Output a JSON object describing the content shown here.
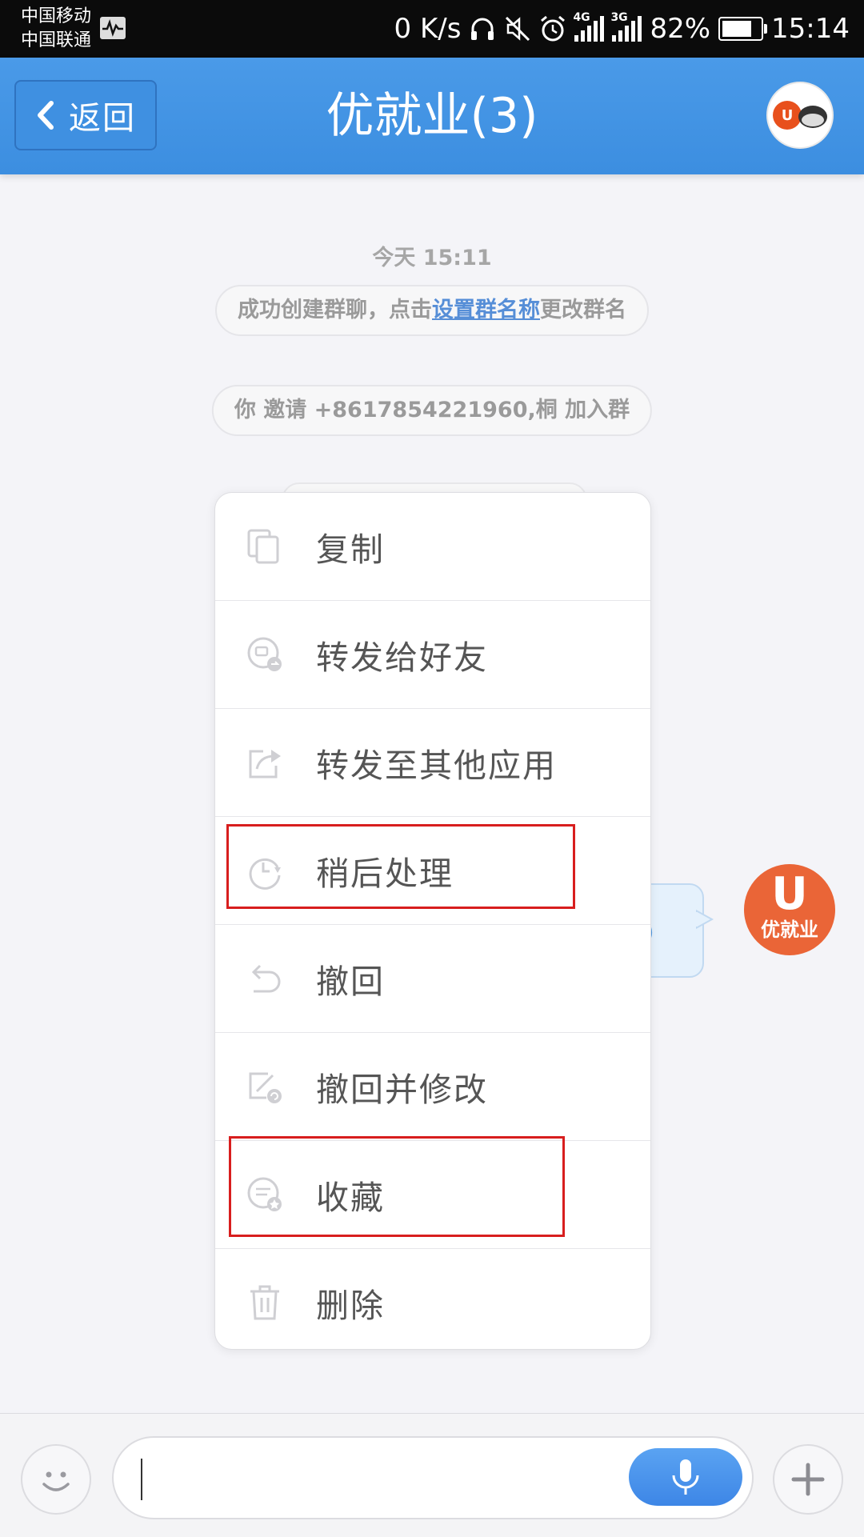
{
  "status_bar": {
    "carrier_1": "中国移动",
    "carrier_2": "中国联通",
    "net_speed": "0 K/s",
    "net_type_1": "4G",
    "net_type_2": "3G",
    "battery": "82%",
    "time": "15:14"
  },
  "header": {
    "back_label": "返回",
    "title": "优就业(3)"
  },
  "chat": {
    "timestamp": "今天 15:11",
    "system_messages": [
      {
        "before": "成功创建群聊，点击",
        "link": "设置群名称",
        "after": "更改群名"
      },
      {
        "text": "你 邀请 +8617854221960,桐 加入群"
      }
    ],
    "avatar_letter": "U",
    "avatar_brand": "优就业"
  },
  "context_menu": {
    "items": [
      {
        "label": "复制",
        "icon": "copy-icon"
      },
      {
        "label": "转发给好友",
        "icon": "forward-friend-icon"
      },
      {
        "label": "转发至其他应用",
        "icon": "share-external-icon"
      },
      {
        "label": "稍后处理",
        "icon": "clock-later-icon",
        "highlighted": true
      },
      {
        "label": "撤回",
        "icon": "undo-icon"
      },
      {
        "label": "撤回并修改",
        "icon": "recall-edit-icon"
      },
      {
        "label": "收藏",
        "icon": "favorite-icon",
        "highlighted": true
      },
      {
        "label": "删除",
        "icon": "trash-icon"
      }
    ]
  },
  "input_bar": {
    "text_value": ""
  },
  "colors": {
    "header_blue": "#4a9ae8",
    "link_blue": "#3f7fd2",
    "highlight_red": "#d81e1e",
    "brand_orange": "#e8501c"
  }
}
